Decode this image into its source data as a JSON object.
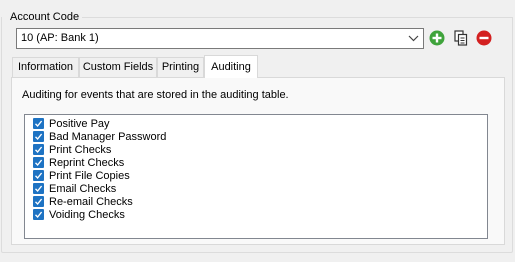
{
  "account": {
    "group_label": "Account Code",
    "selected_value": "10 (AP: Bank 1)"
  },
  "tabs": [
    {
      "label": "Information"
    },
    {
      "label": "Custom Fields"
    },
    {
      "label": "Printing"
    },
    {
      "label": "Auditing",
      "active": true
    }
  ],
  "auditing": {
    "description": "Auditing for events that are stored in the auditing table.",
    "items": [
      {
        "label": "Positive Pay",
        "checked": true
      },
      {
        "label": "Bad Manager Password",
        "checked": true
      },
      {
        "label": "Print Checks",
        "checked": true
      },
      {
        "label": "Reprint Checks",
        "checked": true
      },
      {
        "label": "Print File Copies",
        "checked": true
      },
      {
        "label": "Email Checks",
        "checked": true
      },
      {
        "label": "Re-email Checks",
        "checked": true
      },
      {
        "label": "Voiding Checks",
        "checked": true
      }
    ]
  },
  "colors": {
    "add": "#3fa33b",
    "delete": "#d32020",
    "checkbox": "#1e73c3"
  }
}
